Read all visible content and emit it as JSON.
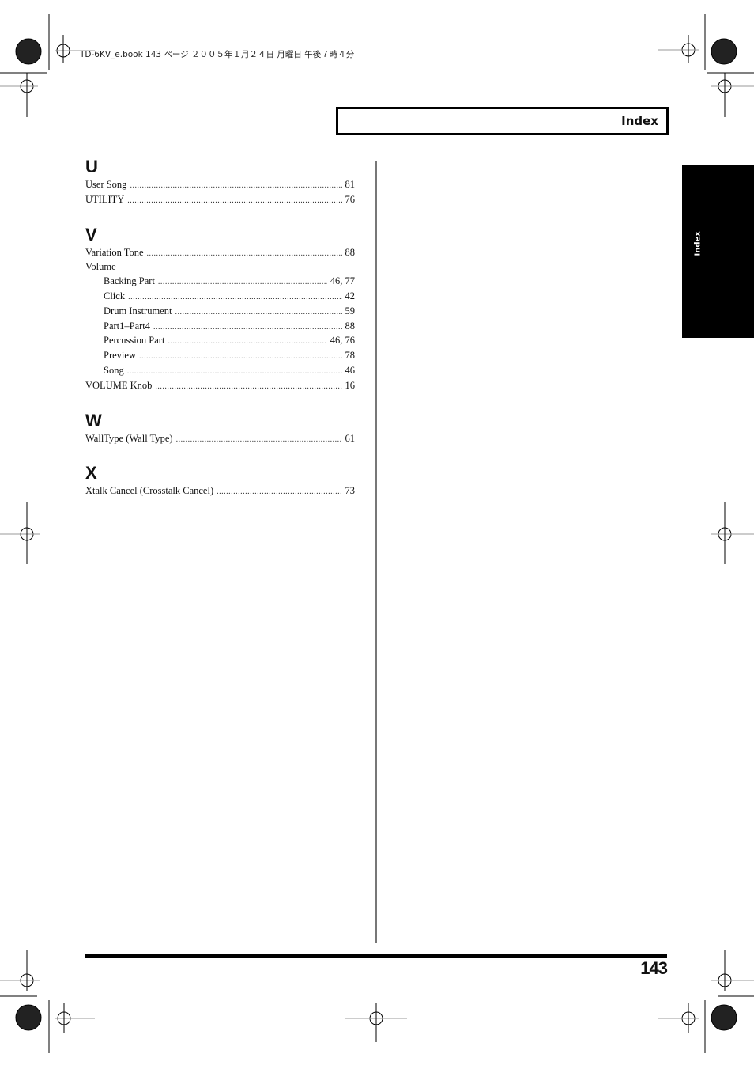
{
  "print_header": "TD-6KV_e.book  143 ページ  ２００５年１月２４日  月曜日  午後７時４分",
  "chapter_title": "Index",
  "side_tab_label": "Index",
  "page_number": "143",
  "sections": [
    {
      "letter": "U",
      "entries": [
        {
          "term": "User Song",
          "pages": "81",
          "level": 0
        },
        {
          "term": "UTILITY",
          "pages": "76",
          "level": 0
        }
      ]
    },
    {
      "letter": "V",
      "entries": [
        {
          "term": "Variation Tone",
          "pages": "88",
          "level": 0
        },
        {
          "term": "Volume",
          "pages": "",
          "level": 0
        },
        {
          "term": "Backing Part",
          "pages": "46, 77",
          "level": 1
        },
        {
          "term": "Click",
          "pages": "42",
          "level": 1
        },
        {
          "term": "Drum Instrument",
          "pages": "59",
          "level": 1
        },
        {
          "term": "Part1–Part4",
          "pages": "88",
          "level": 1
        },
        {
          "term": "Percussion Part",
          "pages": "46, 76",
          "level": 1
        },
        {
          "term": "Preview",
          "pages": "78",
          "level": 1
        },
        {
          "term": "Song",
          "pages": "46",
          "level": 1
        },
        {
          "term": "VOLUME Knob",
          "pages": "16",
          "level": 0
        }
      ]
    },
    {
      "letter": "W",
      "entries": [
        {
          "term": "WallType (Wall Type)",
          "pages": "61",
          "level": 0
        }
      ]
    },
    {
      "letter": "X",
      "entries": [
        {
          "term": "Xtalk Cancel (Crosstalk Cancel)",
          "pages": "73",
          "level": 0
        }
      ]
    }
  ]
}
